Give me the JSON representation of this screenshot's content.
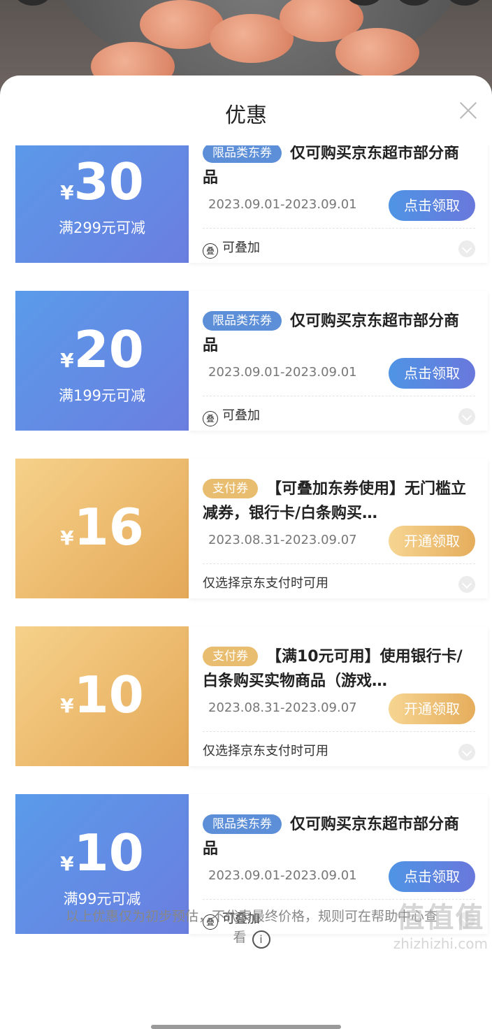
{
  "sheet": {
    "title": "优惠"
  },
  "coupons": [
    {
      "theme": "blue",
      "yen": "¥",
      "amount": "30",
      "condition": "满299元可减",
      "tag": "限品类东券",
      "title": "仅可购买京东超市部分商品",
      "date": "2023.09.01-2023.09.01",
      "button": "点击领取",
      "stack_icon": "叠",
      "footer": "可叠加"
    },
    {
      "theme": "blue",
      "yen": "¥",
      "amount": "20",
      "condition": "满199元可减",
      "tag": "限品类东券",
      "title": "仅可购买京东超市部分商品",
      "date": "2023.09.01-2023.09.01",
      "button": "点击领取",
      "stack_icon": "叠",
      "footer": "可叠加"
    },
    {
      "theme": "gold",
      "yen": "¥",
      "amount": "16",
      "condition": "",
      "tag": "支付券",
      "title": "【可叠加东券使用】无门槛立减券，银行卡/白条购买…",
      "date": "2023.08.31-2023.09.07",
      "button": "开通领取",
      "footer": "仅选择京东支付时可用"
    },
    {
      "theme": "gold",
      "yen": "¥",
      "amount": "10",
      "condition": "",
      "tag": "支付券",
      "title": "【满10元可用】使用银行卡/白条购买实物商品（游戏…",
      "date": "2023.08.31-2023.09.07",
      "button": "开通领取",
      "footer": "仅选择京东支付时可用"
    },
    {
      "theme": "blue",
      "yen": "¥",
      "amount": "10",
      "condition": "满99元可减",
      "tag": "限品类东券",
      "title": "仅可购买京东超市部分商品",
      "date": "2023.09.01-2023.09.01",
      "button": "点击领取",
      "stack_icon": "叠",
      "footer": "可叠加"
    }
  ],
  "disclaimer": {
    "line1": "以上优惠仅为初步预估，不代表最终价格，规则可在帮助中心查",
    "line2": "看",
    "info_icon": "i"
  },
  "watermark": {
    "text1": "值值值",
    "text2": "zhizhizhi.com"
  },
  "colors": {
    "blue_start": "#5a9bea",
    "blue_end": "#6b7ee0",
    "gold_start": "#f6d18a",
    "gold_end": "#e4a858"
  },
  "icons": {
    "close": "close-icon",
    "stack": "stack-icon",
    "chevron": "chevron-down-icon",
    "info": "info-icon"
  }
}
